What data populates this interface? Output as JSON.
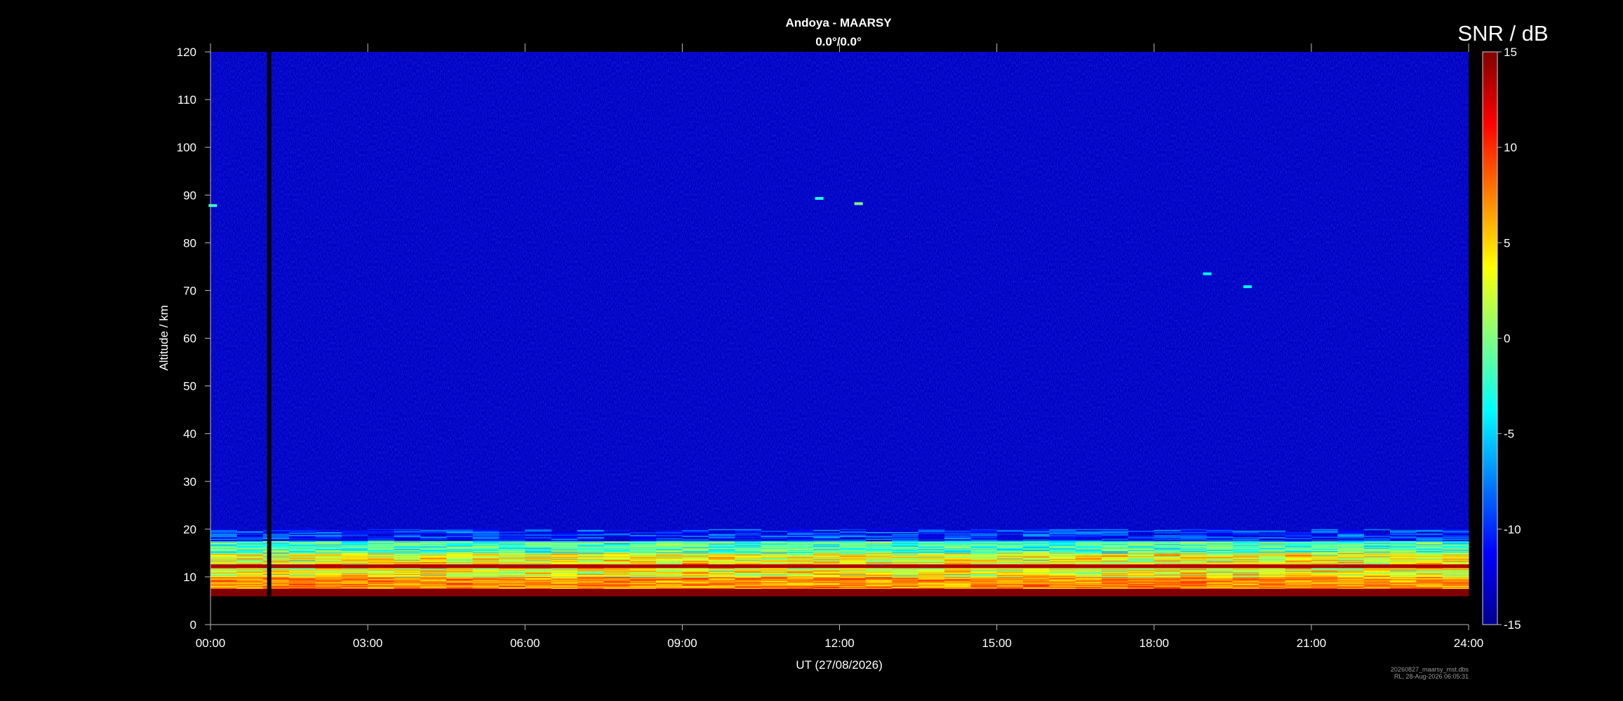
{
  "chart_data": {
    "type": "heatmap",
    "title": "Andoya - MAARSY",
    "subtitle": "0.0°/0.0°",
    "xlabel": "UT (27/08/2026)",
    "ylabel": "Altitude / km",
    "colorbar_label": "SNR / dB",
    "x_tick_labels": [
      "00:00",
      "03:00",
      "06:00",
      "09:00",
      "12:00",
      "15:00",
      "18:00",
      "21:00",
      "24:00"
    ],
    "x_ticks_hours": [
      0,
      3,
      6,
      9,
      12,
      15,
      18,
      21,
      24
    ],
    "xlim_hours": [
      0,
      24
    ],
    "y_ticks": [
      0,
      10,
      20,
      30,
      40,
      50,
      60,
      70,
      80,
      90,
      100,
      110,
      120
    ],
    "ylim": [
      0,
      120
    ],
    "colorbar_ticks": [
      15,
      10,
      5,
      0,
      -5,
      -10,
      -15
    ],
    "clim": [
      -15,
      15
    ],
    "colormap": "jet",
    "background_snr_db": -13,
    "data_gaps": [
      {
        "time_start_hours": 1.08,
        "time_end_hours": 1.16
      }
    ],
    "layers": [
      {
        "name": "tropospheric echoes",
        "alt_range_km": [
          6,
          20
        ],
        "snr_range_db": [
          -8,
          15
        ]
      },
      {
        "name": "strong layer",
        "alt_km": 12.3,
        "snr_db": 13
      },
      {
        "name": "ground clutter",
        "alt_range_km": [
          6,
          7.5
        ],
        "snr_db": 15
      }
    ],
    "features": [
      {
        "time_hours": 11.6,
        "alt_km": 89.3,
        "snr_db": -3
      },
      {
        "time_hours": 12.35,
        "alt_km": 88.2,
        "snr_db": 0
      },
      {
        "time_hours": 0.03,
        "alt_km": 87.8,
        "snr_db": -2
      },
      {
        "time_hours": 19.0,
        "alt_km": 73.5,
        "snr_db": -4
      },
      {
        "time_hours": 19.77,
        "alt_km": 70.8,
        "snr_db": -4
      }
    ]
  },
  "footer": {
    "filename": "20260827_maarsy_mst.dbs",
    "stamp": "RL, 28-Aug-2026 06:05:31"
  }
}
